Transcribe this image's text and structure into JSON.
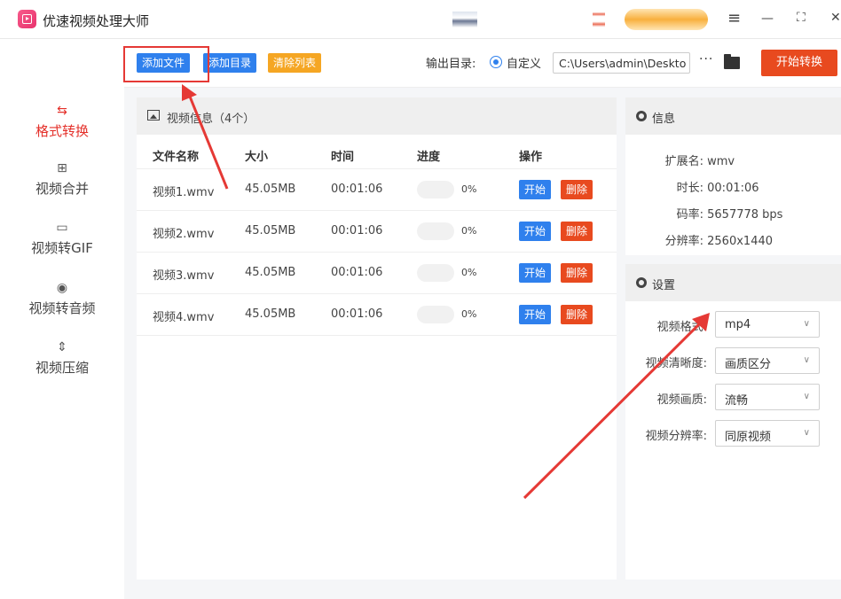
{
  "app": {
    "title": "优速视频处理大师"
  },
  "window_controls": {
    "menu": "≡",
    "minimize": "—",
    "maximize": "⛶",
    "close": "✕"
  },
  "sidebar": {
    "items": [
      {
        "label": "格式转换",
        "icon": "convert-icon",
        "active": true
      },
      {
        "label": "视频合并",
        "icon": "merge-icon",
        "active": false
      },
      {
        "label": "视频转GIF",
        "icon": "gif-icon",
        "active": false
      },
      {
        "label": "视频转音频",
        "icon": "audio-icon",
        "active": false
      },
      {
        "label": "视频压缩",
        "icon": "compress-icon",
        "active": false
      }
    ]
  },
  "toolbar": {
    "add_file": "添加文件",
    "add_folder": "添加目录",
    "clear_list": "清除列表",
    "output_label": "输出目录:",
    "custom_label": "自定义",
    "output_path": "C:\\Users\\admin\\Deskto",
    "more": "···",
    "start_convert": "开始转换"
  },
  "video_panel": {
    "title": "视频信息（4个）",
    "columns": [
      "文件名称",
      "大小",
      "时间",
      "进度",
      "操作"
    ],
    "rows": [
      {
        "name": "视频1.wmv",
        "size": "45.05MB",
        "time": "00:01:06",
        "progress": "0%",
        "start": "开始",
        "delete": "删除"
      },
      {
        "name": "视频2.wmv",
        "size": "45.05MB",
        "time": "00:01:06",
        "progress": "0%",
        "start": "开始",
        "delete": "删除"
      },
      {
        "name": "视频3.wmv",
        "size": "45.05MB",
        "time": "00:01:06",
        "progress": "0%",
        "start": "开始",
        "delete": "删除"
      },
      {
        "name": "视频4.wmv",
        "size": "45.05MB",
        "time": "00:01:06",
        "progress": "0%",
        "start": "开始",
        "delete": "删除"
      }
    ]
  },
  "info_panel": {
    "title": "信息",
    "items": [
      {
        "key": "扩展名:",
        "value": "wmv"
      },
      {
        "key": "时长:",
        "value": "00:01:06"
      },
      {
        "key": "码率:",
        "value": "5657778 bps"
      },
      {
        "key": "分辨率:",
        "value": "2560x1440"
      }
    ]
  },
  "settings_panel": {
    "title": "设置",
    "fields": [
      {
        "label": "视频格式:",
        "value": "mp4"
      },
      {
        "label": "视频清晰度:",
        "value": "画质区分"
      },
      {
        "label": "视频画质:",
        "value": "流畅"
      },
      {
        "label": "视频分辨率:",
        "value": "同原视频"
      }
    ]
  },
  "colors": {
    "accent_blue": "#2f80ed",
    "accent_red": "#e84a1f",
    "accent_orange": "#f5a623",
    "annotation": "#e53935"
  }
}
